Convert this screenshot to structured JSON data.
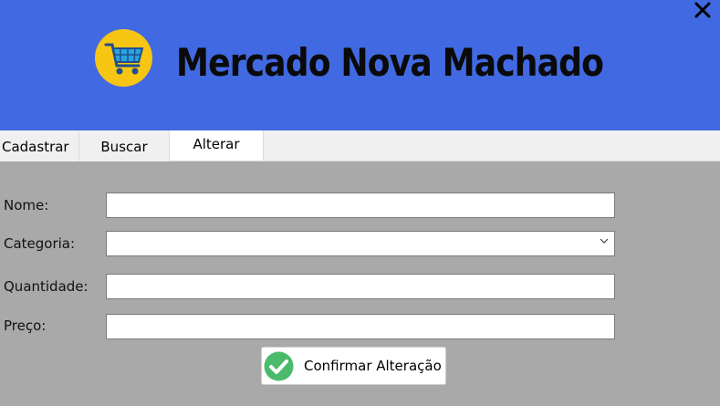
{
  "window": {
    "close_glyph": "✕"
  },
  "header": {
    "title": "Mercado Nova Machado",
    "logo_icon": "shopping-cart-icon",
    "bg_color": "#4169e1"
  },
  "tabs": [
    {
      "label": "Cadastrar",
      "active": false
    },
    {
      "label": "Buscar",
      "active": false
    },
    {
      "label": "Alterar",
      "active": true
    }
  ],
  "form": {
    "nome": {
      "label": "Nome:",
      "value": ""
    },
    "categoria": {
      "label": "Categoria:",
      "value": ""
    },
    "quantidade": {
      "label": "Quantidade:",
      "value": ""
    },
    "preco": {
      "label": "Preço:",
      "value": ""
    },
    "submit_label": "Confirmar Alteração",
    "submit_icon": "check-circle-icon"
  }
}
